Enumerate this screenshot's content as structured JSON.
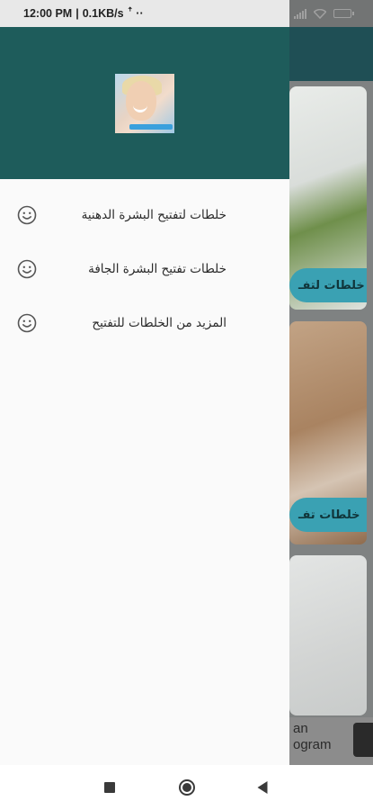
{
  "status_bar": {
    "time": "12:00 PM",
    "separator": "|",
    "net_speed": "0.1KB/s",
    "extra": "ꜛ ··"
  },
  "drawer": {
    "menu_items": [
      {
        "label": "خلطات لتفتيح البشرة الدهنية",
        "icon": "smiley-icon"
      },
      {
        "label": "خلطات تفتيح البشرة الجافة",
        "icon": "smiley-icon"
      },
      {
        "label": "المزيد من الخلطات للتفتيح",
        "icon": "smiley-icon"
      }
    ]
  },
  "background": {
    "card_labels": [
      "خلطات لتفـ",
      "خلطات تفـ"
    ],
    "ad_text": "...an\n...ogram"
  },
  "colors": {
    "drawer_header": "#1e5c5b",
    "drawer_background": "#fafafa",
    "card_label": "#3aa1b3"
  }
}
